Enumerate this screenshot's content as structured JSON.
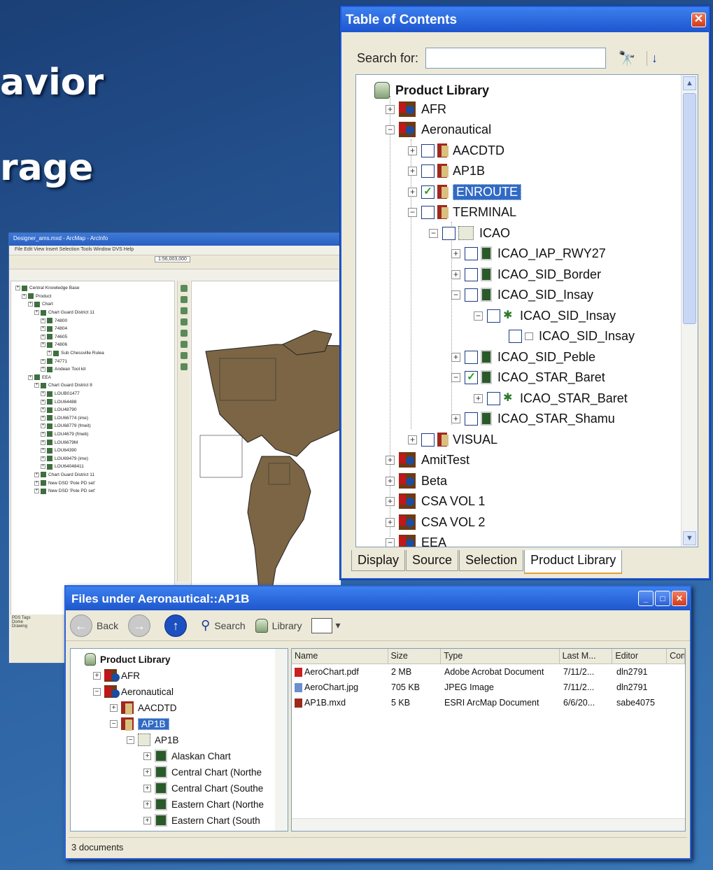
{
  "slide": {
    "line1": "avior",
    "line2": "rage"
  },
  "arcmap": {
    "title": "Designer_ams.mxd - ArcMap - ArcInfo",
    "menu": "File  Edit  View  Insert  Selection  Tools  Window  DVS  Help",
    "scale": "1:56,003,000",
    "tree": [
      "Central Knowledge Base",
      "Product",
      "Chart",
      "Chart Guard District 11",
      "74800",
      "74804",
      "74605",
      "74806",
      "Sub Chessville Rulea",
      "74771",
      "Andean Tool kit",
      "EEA",
      "Chart Guard District 8",
      "LOUB01477",
      "LOU64488",
      "LOU48790",
      "LOU66774 (ime)",
      "LOU68779 (fmeit)",
      "LOU4679 (fmeb)",
      "LOU6679M",
      "LOU64390",
      "LOU69479 (ime)",
      "LOU64048411",
      "Chart Guard District 11",
      "New DSD 'Pole PD set'",
      "New DSD 'Pole PD set'"
    ],
    "bottom": [
      "PDS Tags",
      "Dome",
      "Drawing"
    ]
  },
  "toc": {
    "title": "Table of Contents",
    "close": "✕",
    "search_label": "Search for:",
    "search_value": "",
    "find_icon": "binoculars-icon",
    "sort_icon": "sort-az-icon",
    "nodes": {
      "root": "Product Library",
      "afr": "AFR",
      "aero": "Aeronautical",
      "aacdtd": "AACDTD",
      "ap1b": "AP1B",
      "enroute": "ENROUTE",
      "terminal": "TERMINAL",
      "icao": "ICAO",
      "iap": "ICAO_IAP_RWY27",
      "sid_border": "ICAO_SID_Border",
      "sid_insay": "ICAO_SID_Insay",
      "sid_insay2": "ICAO_SID_Insay",
      "sid_insay3": "ICAO_SID_Insay",
      "sid_peble": "ICAO_SID_Peble",
      "star_baret": "ICAO_STAR_Baret",
      "star_baret2": "ICAO_STAR_Baret",
      "star_shamu": "ICAO_STAR_Shamu",
      "visual": "VISUAL",
      "amittest": "AmitTest",
      "beta": "Beta",
      "csa1": "CSA VOL 1",
      "csa2": "CSA VOL 2",
      "eea": "EEA"
    },
    "tabs": [
      "Display",
      "Source",
      "Selection",
      "Product Library"
    ],
    "active_tab": "Product Library"
  },
  "files": {
    "title": "Files under Aeronautical::AP1B",
    "toolbar": {
      "back": "Back",
      "search": "Search",
      "library": "Library"
    },
    "tree": {
      "root": "Product Library",
      "afr": "AFR",
      "aero": "Aeronautical",
      "aacdtd": "AACDTD",
      "ap1b": "AP1B",
      "ap1b_child": "AP1B",
      "c1": "Alaskan Chart",
      "c2": "Central Chart (Northe",
      "c3": "Central Chart (Southe",
      "c4": "Eastern Chart (Northe",
      "c5": "Eastern Chart (South"
    },
    "columns": [
      "Name",
      "Size",
      "Type",
      "Last M...",
      "Editor",
      "Com"
    ],
    "rows": [
      {
        "name": "AeroChart.pdf",
        "size": "2 MB",
        "type": "Adobe Acrobat Document",
        "date": "7/11/2...",
        "editor": "dln2791",
        "icon": "pdf-file-icon"
      },
      {
        "name": "AeroChart.jpg",
        "size": "705 KB",
        "type": "JPEG Image",
        "date": "7/11/2...",
        "editor": "dln2791",
        "icon": "image-file-icon"
      },
      {
        "name": "AP1B.mxd",
        "size": "5 KB",
        "type": "ESRI ArcMap Document",
        "date": "6/6/20...",
        "editor": "sabe4075",
        "icon": "mxd-file-icon"
      }
    ],
    "status": "3 documents"
  },
  "colors": {
    "accent": "#316ac5",
    "title_bar": "#2259d0",
    "check": "#19a119"
  }
}
